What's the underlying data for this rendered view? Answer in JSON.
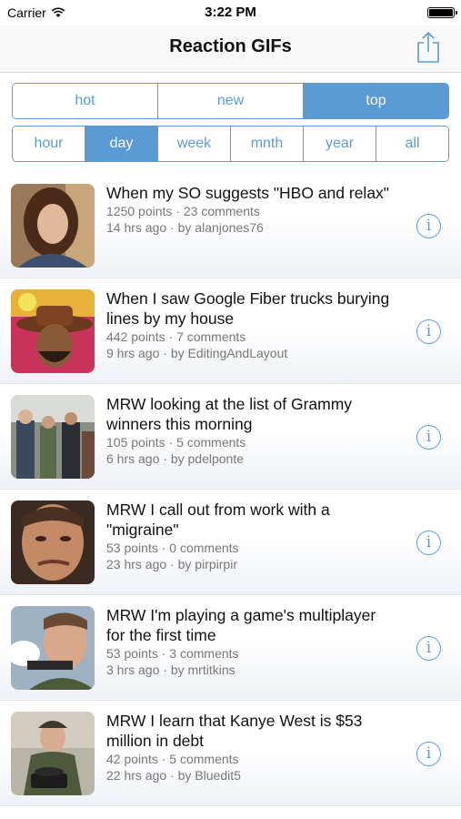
{
  "status_bar": {
    "carrier": "Carrier",
    "time": "3:22 PM"
  },
  "nav": {
    "title": "Reaction GIFs"
  },
  "sort_tabs": [
    {
      "label": "hot",
      "active": false
    },
    {
      "label": "new",
      "active": false
    },
    {
      "label": "top",
      "active": true
    }
  ],
  "time_tabs": [
    {
      "label": "hour",
      "active": false
    },
    {
      "label": "day",
      "active": true
    },
    {
      "label": "week",
      "active": false
    },
    {
      "label": "mnth",
      "active": false
    },
    {
      "label": "year",
      "active": false
    },
    {
      "label": "all",
      "active": false
    }
  ],
  "posts": [
    {
      "title": "When my SO suggests \"HBO and relax\"",
      "points": "1250 points",
      "comments": "23 comments",
      "age": "14 hrs ago",
      "author": "by alanjones76",
      "thumb_icon": "woman-portrait-thumbnail"
    },
    {
      "title": "When I saw Google Fiber trucks burying lines by my house",
      "points": "442 points",
      "comments": "7 comments",
      "age": "9 hrs ago",
      "author": "by EditingAndLayout",
      "thumb_icon": "hat-man-thumbnail"
    },
    {
      "title": "MRW looking at the list of Grammy winners this morning",
      "points": "105 points",
      "comments": "5 comments",
      "age": "6 hrs ago",
      "author": "by pdelponte",
      "thumb_icon": "crowd-scene-thumbnail"
    },
    {
      "title": "MRW I call out from work with a \"migraine\"",
      "points": "53 points",
      "comments": "0 comments",
      "age": "23 hrs ago",
      "author": "by pirpirpir",
      "thumb_icon": "man-face-thumbnail"
    },
    {
      "title": "MRW I'm playing a game's multiplayer for the first time",
      "points": "53 points",
      "comments": "3 comments",
      "age": "3 hrs ago",
      "author": "by mrtitkins",
      "thumb_icon": "man-firing-thumbnail"
    },
    {
      "title": "MRW I learn that Kanye West is $53 million in debt",
      "points": "42 points",
      "comments": "5 comments",
      "age": "22 hrs ago",
      "author": "by Bluedit5",
      "thumb_icon": "officer-telephone-thumbnail"
    }
  ],
  "meta_separator": " · ",
  "colors": {
    "accent": "#5b9bd5",
    "meta_text": "#777777"
  }
}
